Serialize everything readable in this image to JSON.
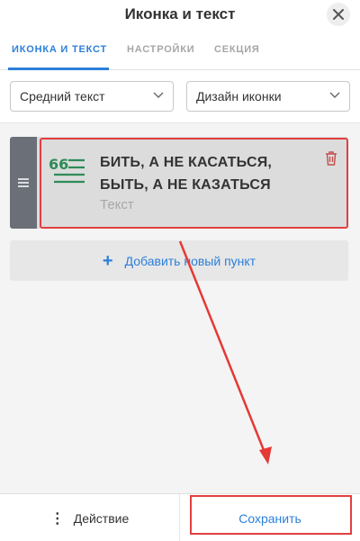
{
  "header": {
    "title": "Иконка и текст",
    "close_icon": "close-icon"
  },
  "tabs": [
    {
      "label": "ИКОНКА И ТЕКСТ",
      "active": true
    },
    {
      "label": "НАСТРОЙКИ",
      "active": false
    },
    {
      "label": "СЕКЦИЯ",
      "active": false
    }
  ],
  "selects": {
    "text_size": "Средний текст",
    "icon_design": "Дизайн иконки"
  },
  "item": {
    "title": "БИТЬ, А НЕ КАСАТЬСЯ, БЫТЬ, А НЕ КАЗАТЬСЯ",
    "subtitle": "Текст",
    "icon": "quote-list-icon",
    "delete_icon": "trash-icon",
    "handle_icon": "drag-handle-icon"
  },
  "add_button": {
    "label": "Добавить новый пункт"
  },
  "footer": {
    "action_label": "Действие",
    "save_label": "Сохранить"
  },
  "colors": {
    "accent": "#2c7fd9",
    "highlight": "#e24040",
    "icon_green": "#2e8b57",
    "handle": "#6b6f78"
  }
}
